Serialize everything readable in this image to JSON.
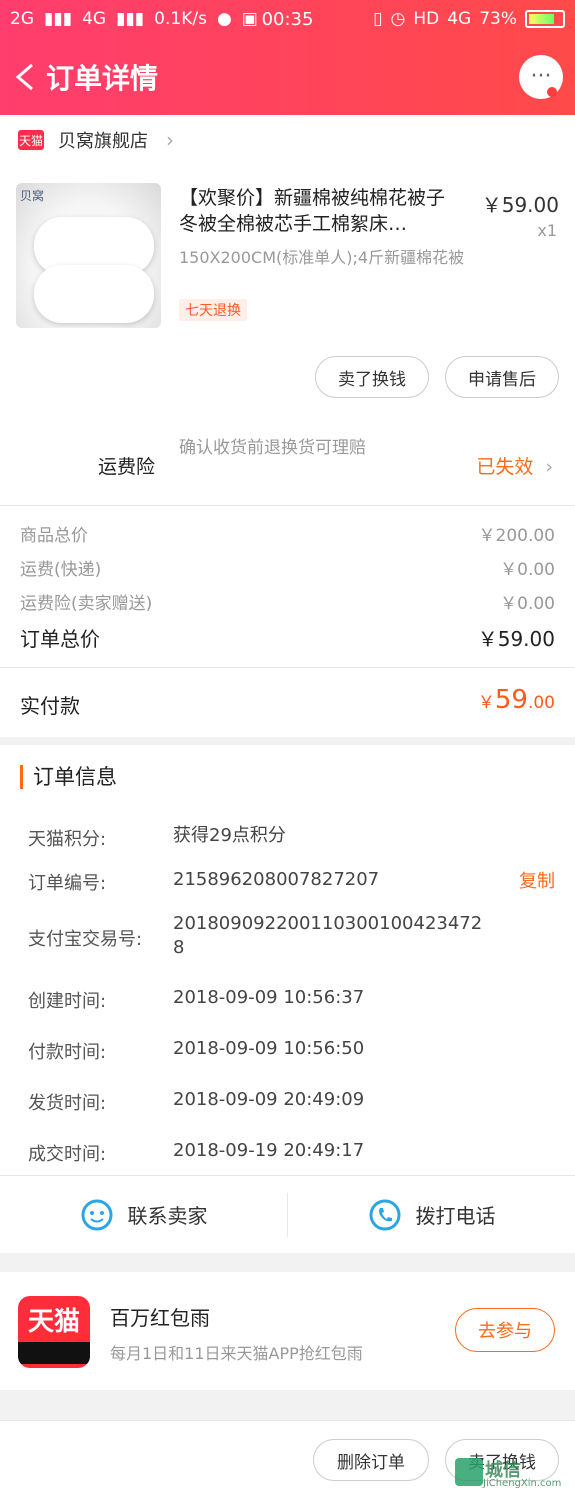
{
  "status_bar": {
    "network_left": "2G",
    "network_mid": "4G",
    "speed": "0.1K/s",
    "time": "00:35",
    "hd": "HD",
    "network_right": "4G",
    "battery": "73%"
  },
  "nav": {
    "title": "订单详情",
    "more_label": "···"
  },
  "store": {
    "badge": "天猫",
    "name": "贝窝旗舰店",
    "chevron": "›"
  },
  "product": {
    "brand": "贝窝",
    "title": "【欢聚价】新疆棉被纯棉花被子冬被全棉被芯手工棉絮床…",
    "price": "￥59.00",
    "qty": "x1",
    "sku": "150X200CM(标准单人);4斤新疆棉花被",
    "tag": "七天退换",
    "btn_sell": "卖了换钱",
    "btn_after_sale": "申请售后"
  },
  "insurance": {
    "label": "运费险",
    "desc": "确认收货前退换货可理赔",
    "status": "已失效",
    "chevron": "›"
  },
  "summary": {
    "rows": [
      {
        "label": "商品总价",
        "value": "￥200.00"
      },
      {
        "label": "运费(快递)",
        "value": "￥0.00"
      },
      {
        "label": "运费险(卖家赠送)",
        "value": "￥0.00"
      }
    ],
    "total_label": "订单总价",
    "total_value": "￥59.00",
    "paid_label": "实付款",
    "paid_currency": "￥",
    "paid_int": "59",
    "paid_dec": ".00"
  },
  "order_info": {
    "title": "订单信息",
    "rows": [
      {
        "label": "天猫积分:",
        "value": "获得29点积分"
      },
      {
        "label": "订单编号:",
        "value": "215896208007827207"
      },
      {
        "label": "支付宝交易号:",
        "value": "2018090922001103001004234728"
      },
      {
        "label": "创建时间:",
        "value": "2018-09-09 10:56:37"
      },
      {
        "label": "付款时间:",
        "value": "2018-09-09 10:56:50"
      },
      {
        "label": "发货时间:",
        "value": "2018-09-09 20:49:09"
      },
      {
        "label": "成交时间:",
        "value": "2018-09-19 20:49:17"
      }
    ],
    "copy_label": "复制"
  },
  "contact": {
    "seller": "联系卖家",
    "phone": "拨打电话"
  },
  "promo": {
    "logo": "天猫",
    "title": "百万红包雨",
    "desc": "每月1日和11日来天猫APP抢红包雨",
    "button": "去参与"
  },
  "bottom": {
    "delete": "删除订单",
    "sell": "卖了换钱",
    "watermark_text": "城信",
    "watermark_url": "JiChengXin.com"
  },
  "colors": {
    "header_start": "#ff3d6e",
    "header_end": "#ff4a4a",
    "accent_orange": "#ff6a1a",
    "icon_blue": "#2aa6e8"
  }
}
